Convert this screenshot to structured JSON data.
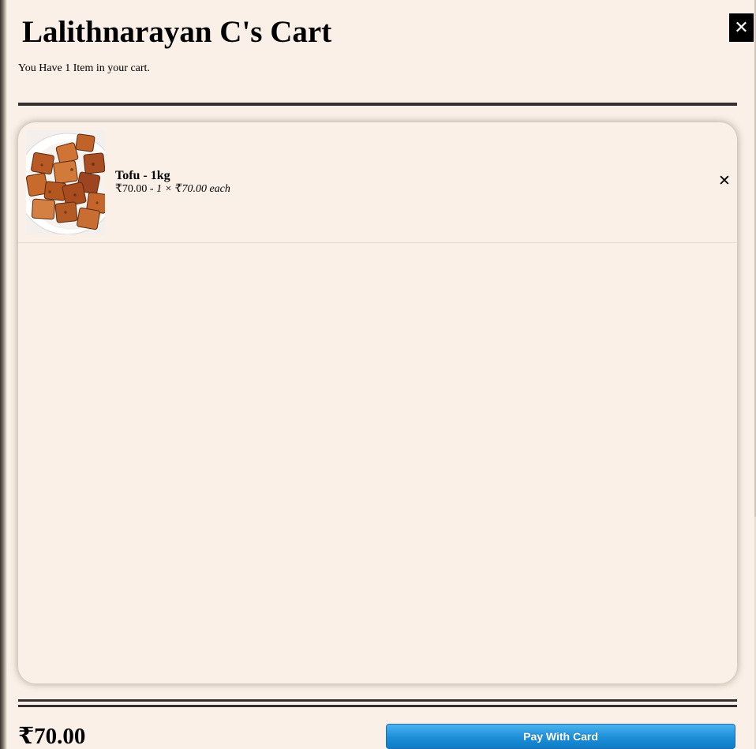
{
  "cart": {
    "title": "Lalithnarayan C's Cart",
    "subtitle": "You Have 1 Item in your cart.",
    "close_icon": "✕",
    "items": [
      {
        "name": "Tofu - 1kg",
        "line_total": "₹70.00",
        "separator": " - ",
        "quantity_detail": "1 × ₹70.00 each",
        "remove_icon": "✕",
        "image_icon": "tofu-image"
      }
    ],
    "total": "₹70.00",
    "pay_button_label": "Pay With Card"
  },
  "colors": {
    "background": "#faf0e7",
    "rule": "#353030",
    "close_button_bg": "#000000",
    "pay_button": "#1c8ed8"
  }
}
